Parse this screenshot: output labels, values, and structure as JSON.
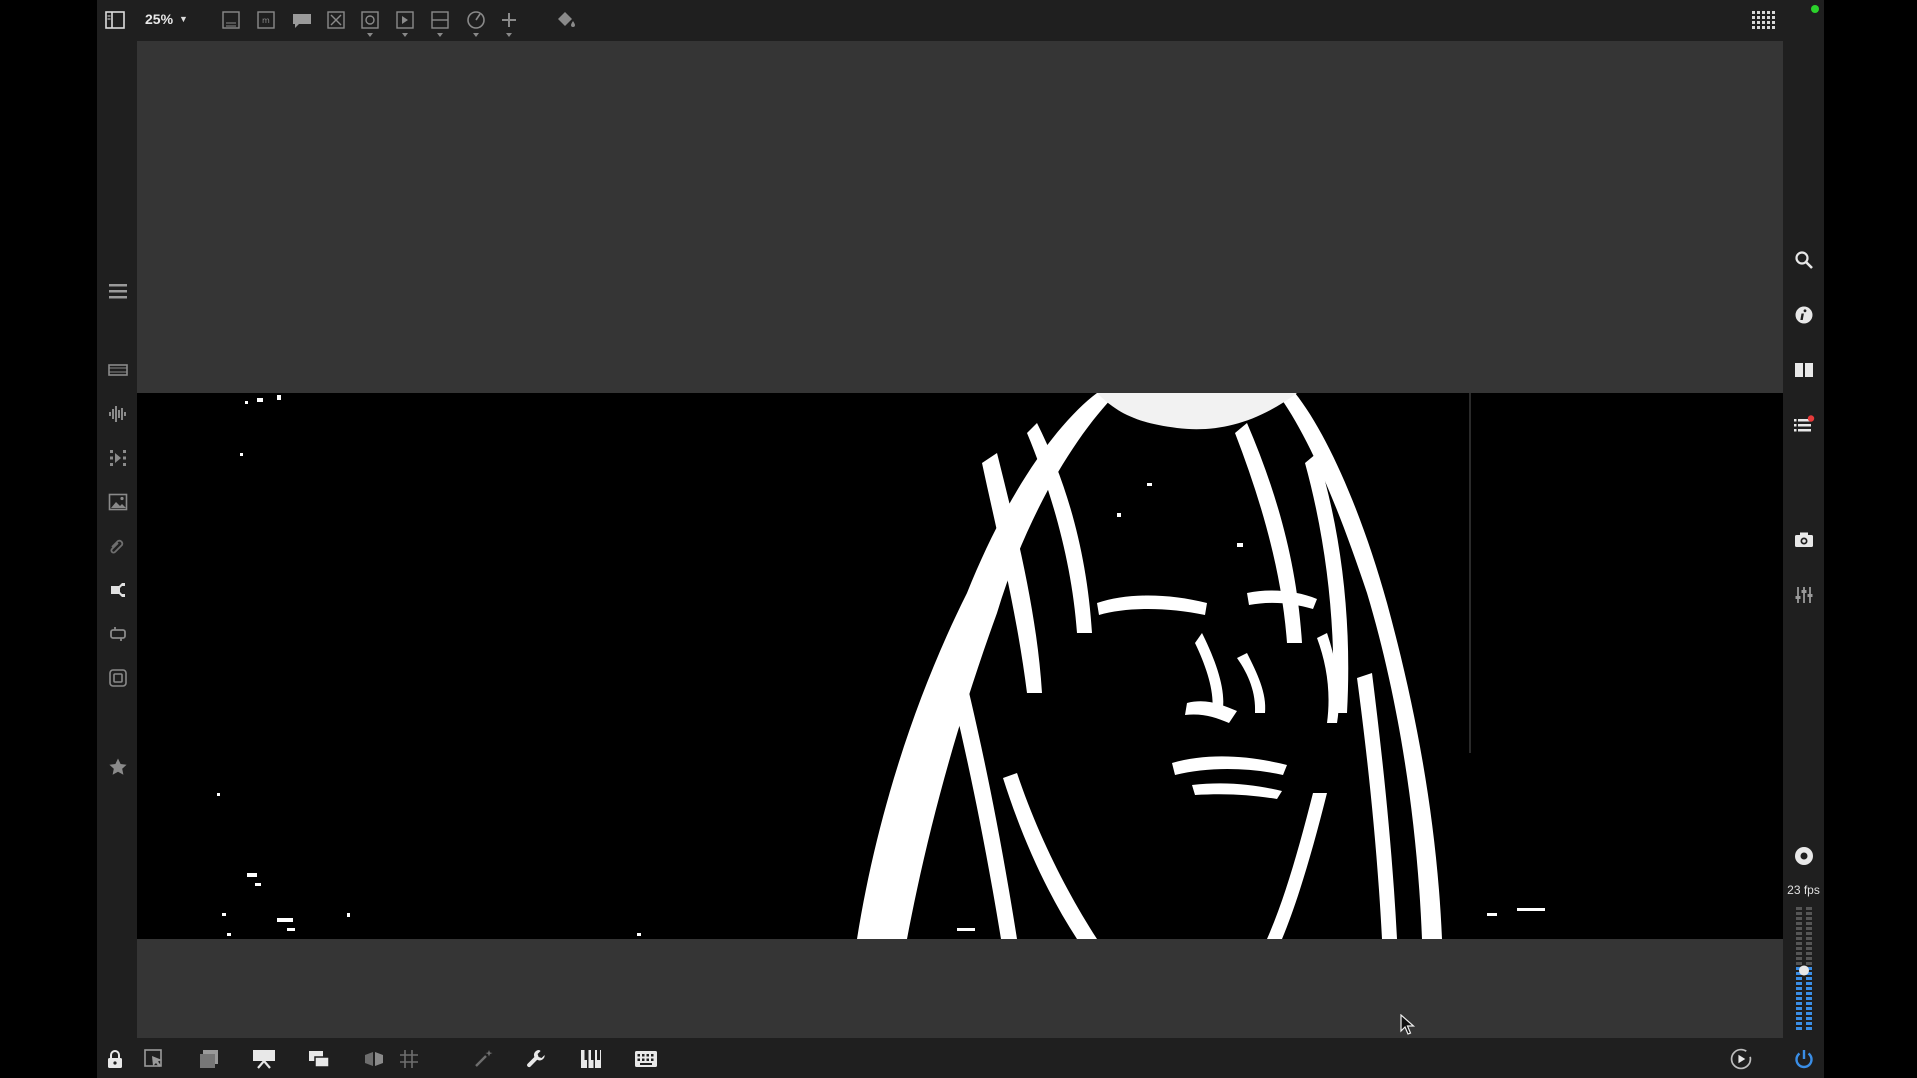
{
  "toolbar": {
    "zoom_value": "25%",
    "icons": [
      "sidebar-toggle-icon",
      "layout-icon",
      "text-layer-icon",
      "speech-bubble-icon",
      "clear-icon",
      "target-icon",
      "play-layer-icon",
      "split-icon",
      "speed-icon",
      "add-icon",
      "paint-bucket-icon",
      "keyboard-grid-icon"
    ]
  },
  "left_sidebar": {
    "icons": [
      "menu-icon",
      "film-strip-icon",
      "audio-waveform-icon",
      "sequence-icon",
      "image-icon",
      "attachment-icon",
      "plugin-icon",
      "loop-icon",
      "frame-icon",
      "star-icon"
    ]
  },
  "right_sidebar": {
    "icons": [
      "search-icon",
      "info-icon",
      "book-icon",
      "list-icon",
      "camera-icon",
      "sliders-icon",
      "record-icon",
      "power-icon"
    ],
    "notification_color": "#e63b3b",
    "fps_label": "23 fps",
    "meter_level": 0.52
  },
  "bottom_bar": {
    "icons": [
      "lock-icon",
      "cursor-select-icon",
      "layers-icon",
      "presentation-icon",
      "windows-icon",
      "swap-icon",
      "grid-icon",
      "magic-wand-icon",
      "wrench-icon",
      "piano-icon",
      "keyboard-icon",
      "play-circle-icon"
    ]
  },
  "colors": {
    "accent_blue": "#3a8ee6",
    "status_green": "#2bd12b",
    "canvas_bg": "#353535",
    "panel_bg": "#1f1f1f"
  }
}
